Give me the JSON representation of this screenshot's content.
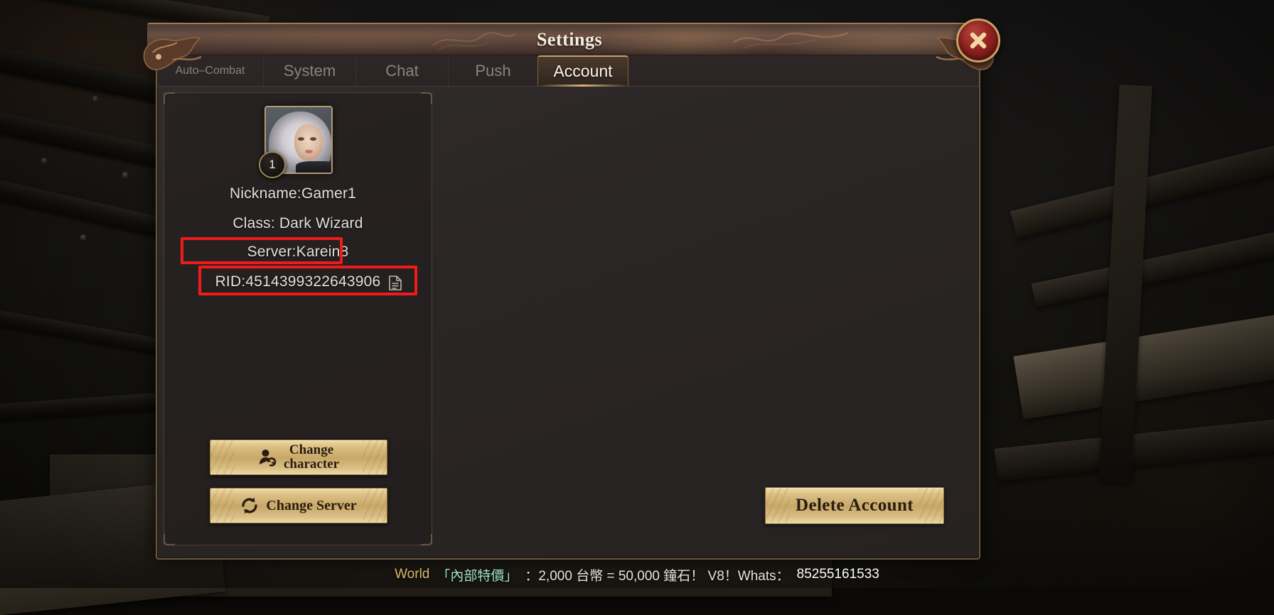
{
  "window": {
    "title": "Settings",
    "close_icon": "close-x-icon"
  },
  "tabs": [
    {
      "label": "Auto–Combat",
      "active": false,
      "small": true
    },
    {
      "label": "System",
      "active": false,
      "small": false
    },
    {
      "label": "Chat",
      "active": false,
      "small": false
    },
    {
      "label": "Push",
      "active": false,
      "small": false
    },
    {
      "label": "Account",
      "active": true,
      "small": false
    }
  ],
  "account": {
    "avatar": {
      "level": "1",
      "icon": "character-portrait"
    },
    "nickname_line": "Nickname:Gamer1",
    "class_line": "Class: Dark Wizard",
    "server_line": "Server:Karein8",
    "rid_line": "RID:4514399322643906",
    "copy_icon": "copy-document-icon",
    "nickname_value": "Gamer1",
    "class_value": "Dark Wizard",
    "server_value": "Karein8",
    "rid_value": "4514399322643906"
  },
  "buttons": {
    "change_character": "Change\ncharacter",
    "change_character_l1": "Change",
    "change_character_l2": "character",
    "change_character_icon": "user-switch-icon",
    "change_server": "Change Server",
    "change_server_icon": "refresh-cycle-icon",
    "delete_account": "Delete Account"
  },
  "highlights": {
    "server_box_color": "#f01a1a",
    "rid_box_color": "#f01a1a"
  },
  "chat": {
    "channel": "World",
    "tag": "「內部特價」",
    "message": "：2,000 台幣 = 50,000 鐘石！ V8！Whats：",
    "phone": "85255161533"
  },
  "colors": {
    "gold": "#c9a468",
    "accent_red": "#93231f",
    "panel_bg": "#2b2626"
  }
}
